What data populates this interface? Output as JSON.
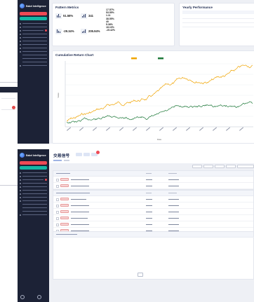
{
  "app": {
    "brand": "Eabel Intelligence"
  },
  "pattern_metrics": {
    "title": "Pattern Metrics",
    "win_rate": {
      "label": "",
      "value": "51.58%"
    },
    "total_signals": {
      "label": "",
      "value": "341"
    },
    "max_drawdown": {
      "label": "",
      "value": "-29.34%"
    },
    "cumulative_return": {
      "label": "",
      "value": "205.94%"
    }
  },
  "stats": [
    {
      "key": "",
      "value": "17.57%"
    },
    {
      "key": "",
      "value": "53.55%"
    },
    {
      "key": "",
      "value": "1.11"
    },
    {
      "key": "",
      "value": "38.55%"
    },
    {
      "key": "",
      "value": "40"
    },
    {
      "key": "",
      "value": "5.36%"
    },
    {
      "key": "",
      "value": "18.10%"
    },
    {
      "key": "",
      "value": "-15.42%"
    }
  ],
  "yearly": {
    "title": "Yearly Performance"
  },
  "chart_data": {
    "type": "line",
    "title": "Cumulative Return Chart",
    "xlabel": "Date",
    "ylabel": "Value",
    "legend_position": "top",
    "series": [
      {
        "name": "",
        "color": "#f0a400"
      },
      {
        "name": "",
        "color": "#1f7a3a"
      }
    ]
  },
  "trade_signals": {
    "title": "交易信号",
    "groups": [
      {
        "rows": 2
      },
      {
        "rows": 6
      },
      {
        "rows": 0
      }
    ]
  },
  "colors": {
    "sidebar": "#1c2236",
    "accent_red": "#ef4a55",
    "accent_teal": "#14b8a6"
  }
}
